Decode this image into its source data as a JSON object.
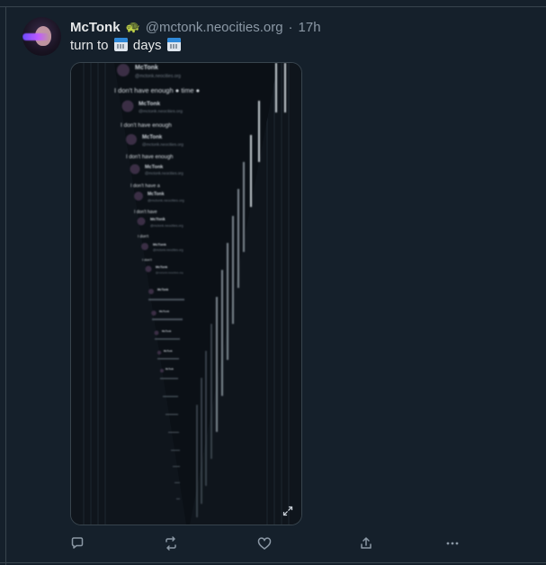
{
  "post": {
    "display_name": "McTonk",
    "badge_emoji": "🐢",
    "handle": "@mctonk.neocities.org",
    "separator": "·",
    "time": "17h",
    "text_before": "turn to",
    "text_middle": "days"
  },
  "media": {
    "icons": {
      "expand": "expand-icon"
    },
    "nested_name": "McTonk",
    "nested_handle": "@mctonk.neocities.org",
    "nested_lines": [
      "I don't have enough ● time ●",
      "I don't have enough",
      "I don't have enough",
      "I don't have a",
      "I don't have",
      "I don't",
      "I don't"
    ]
  },
  "actions": {
    "icons": [
      "reply-icon",
      "repost-icon",
      "like-icon",
      "share-icon",
      "more-icon"
    ]
  },
  "colors": {
    "background": "#15202b",
    "secondary_text": "#8b98a5",
    "border": "#38444d"
  }
}
